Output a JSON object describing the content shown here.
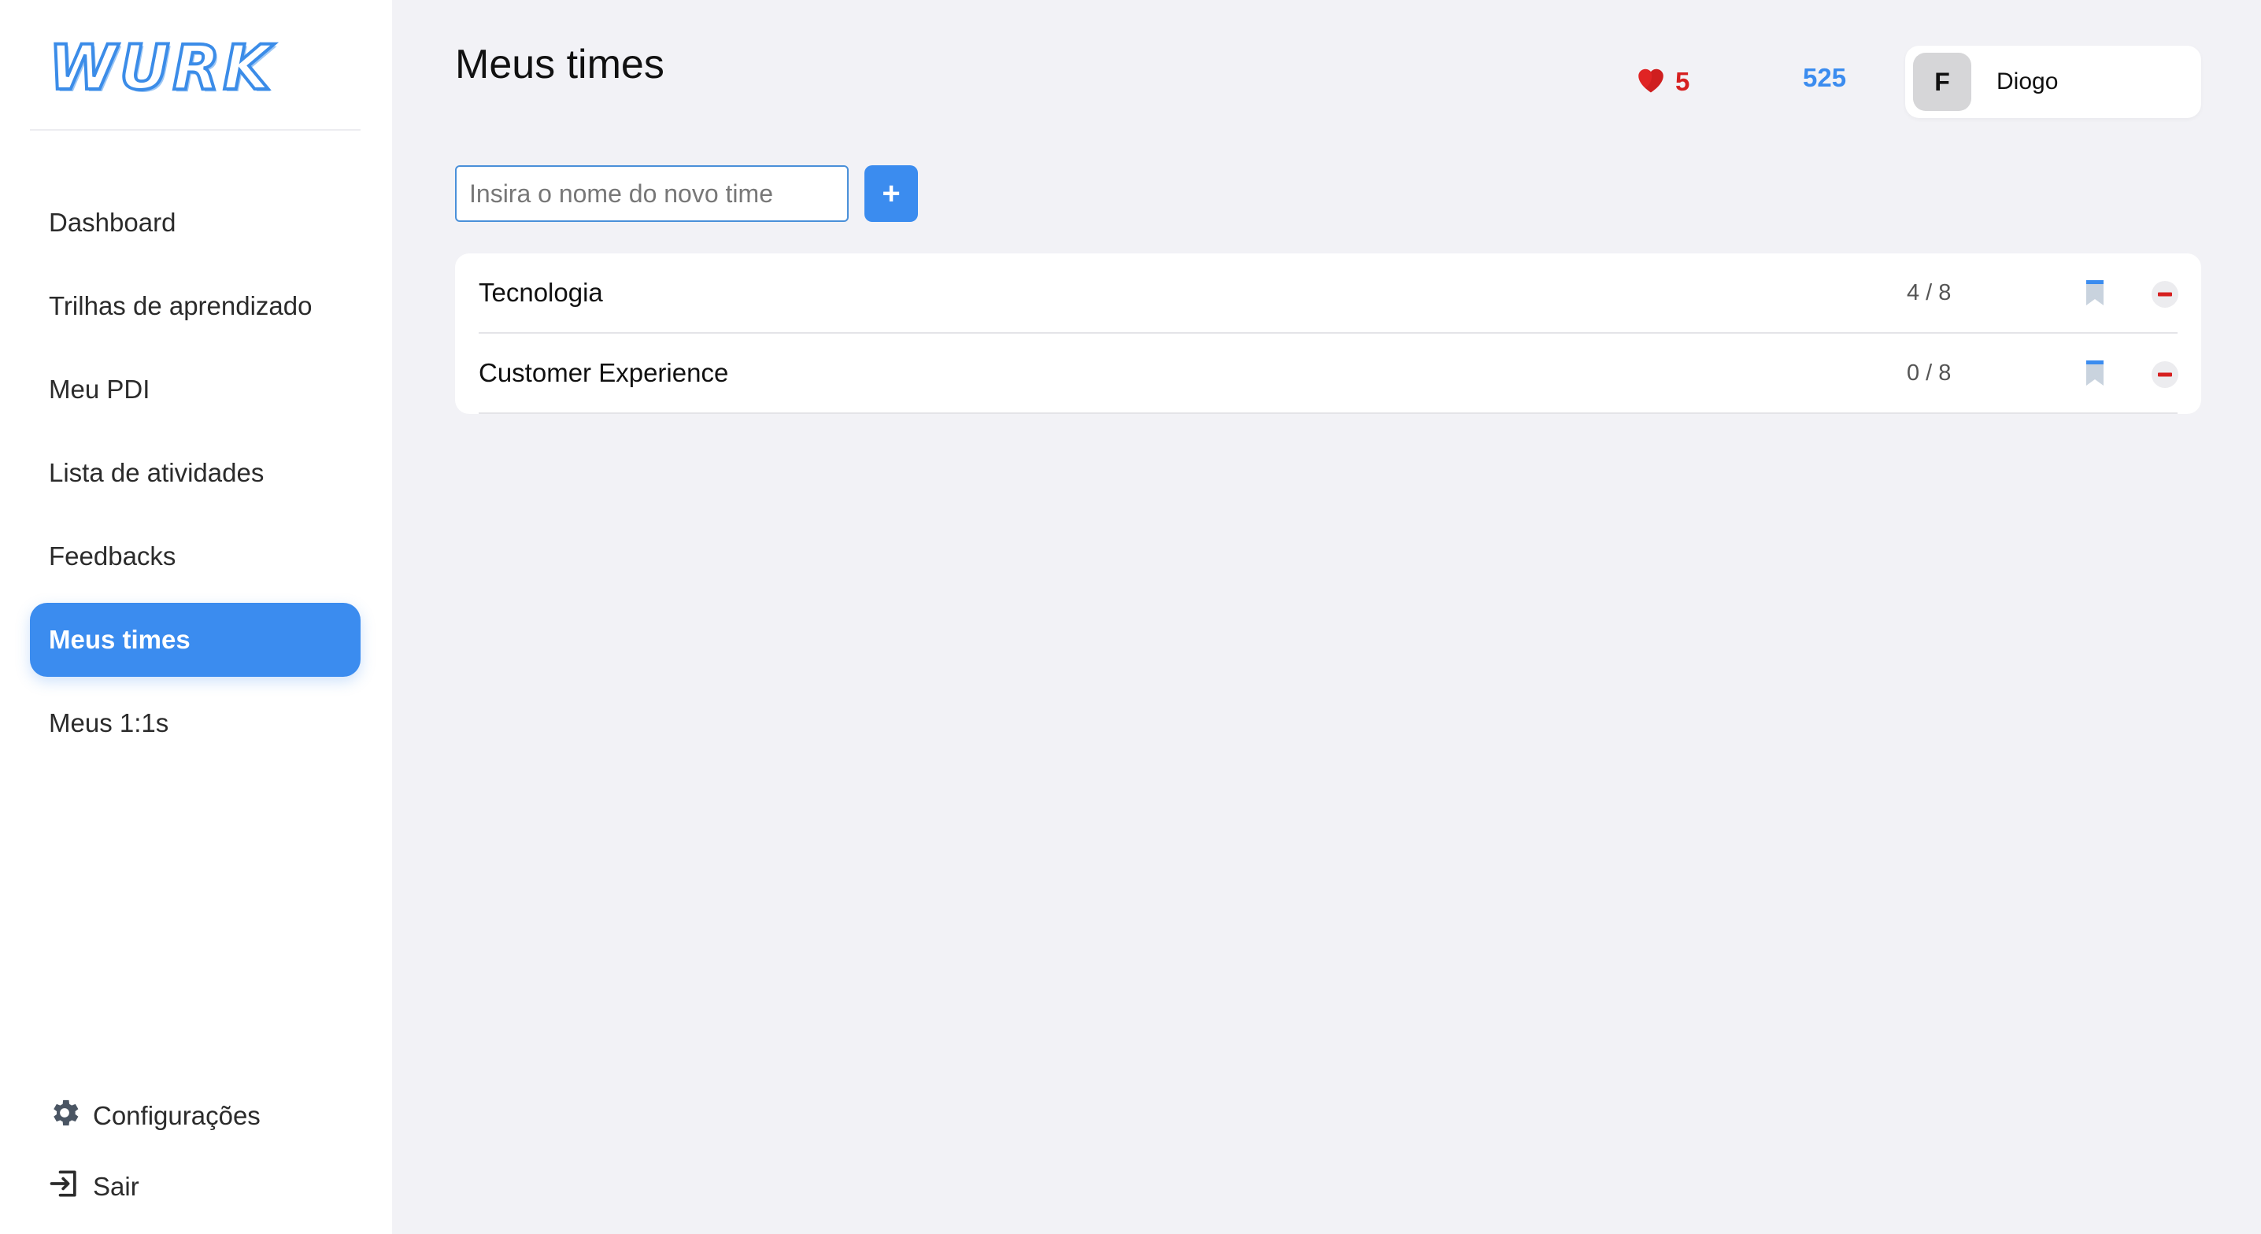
{
  "brand": {
    "logo_text": "WURK",
    "accent": "#3b8cef"
  },
  "sidebar": {
    "items": [
      {
        "label": "Dashboard",
        "active": false
      },
      {
        "label": "Trilhas de aprendizado",
        "active": false
      },
      {
        "label": "Meu PDI",
        "active": false
      },
      {
        "label": "Lista de atividades",
        "active": false
      },
      {
        "label": "Feedbacks",
        "active": false
      },
      {
        "label": "Meus times",
        "active": true
      },
      {
        "label": "Meus 1:1s",
        "active": false
      }
    ],
    "settings_label": "Configurações",
    "logout_label": "Sair"
  },
  "header": {
    "title": "Meus times",
    "hearts": "5",
    "points": "525",
    "user": {
      "avatar_initial": "F",
      "name": "Diogo"
    }
  },
  "new_team": {
    "placeholder": "Insira o nome do novo time",
    "value": "",
    "add_label": "+"
  },
  "teams": [
    {
      "name": "Tecnologia",
      "count": "4 / 8"
    },
    {
      "name": "Customer Experience",
      "count": "0 / 8"
    }
  ]
}
